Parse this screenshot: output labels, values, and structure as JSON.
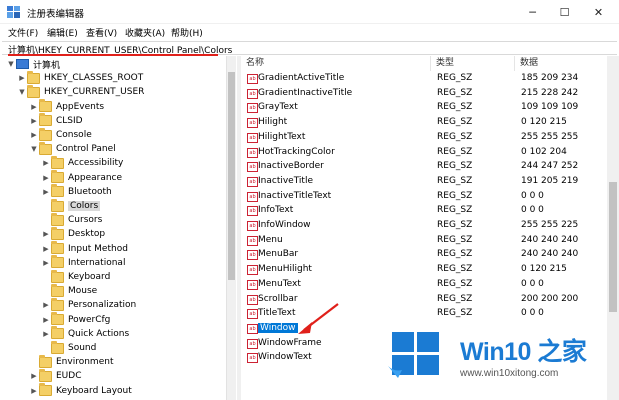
{
  "window": {
    "title": "注册表编辑器",
    "controls": {
      "minimize": "─",
      "maximize": "☐",
      "close": "✕"
    }
  },
  "menu": [
    "文件(F)",
    "编辑(E)",
    "查看(V)",
    "收藏夹(A)",
    "帮助(H)"
  ],
  "address": "计算机\\HKEY_CURRENT_USER\\Control Panel\\Colors",
  "colors": {
    "selection": "#0078d7",
    "accent": "#1b7bd3",
    "annotation": "#e0201a"
  },
  "tree": [
    {
      "label": "计算机",
      "arrow": "▼",
      "icon": "computer-icon"
    },
    {
      "label": "HKEY_CLASSES_ROOT",
      "arrow": "▶",
      "icon": "folder-icon"
    },
    {
      "label": "HKEY_CURRENT_USER",
      "arrow": "▼",
      "icon": "folder-icon"
    },
    {
      "label": "AppEvents",
      "arrow": "▶",
      "icon": "folder-icon"
    },
    {
      "label": "CLSID",
      "arrow": "▶",
      "icon": "folder-icon"
    },
    {
      "label": "Console",
      "arrow": "▶",
      "icon": "folder-icon"
    },
    {
      "label": "Control Panel",
      "arrow": "▼",
      "icon": "folder-icon"
    },
    {
      "label": "Accessibility",
      "arrow": "▶",
      "icon": "folder-icon"
    },
    {
      "label": "Appearance",
      "arrow": "▶",
      "icon": "folder-icon"
    },
    {
      "label": "Bluetooth",
      "arrow": "▶",
      "icon": "folder-icon"
    },
    {
      "label": "Colors",
      "arrow": "",
      "icon": "folder-icon",
      "selected": true
    },
    {
      "label": "Cursors",
      "arrow": "",
      "icon": "folder-icon"
    },
    {
      "label": "Desktop",
      "arrow": "▶",
      "icon": "folder-icon"
    },
    {
      "label": "Input Method",
      "arrow": "▶",
      "icon": "folder-icon"
    },
    {
      "label": "International",
      "arrow": "▶",
      "icon": "folder-icon"
    },
    {
      "label": "Keyboard",
      "arrow": "",
      "icon": "folder-icon"
    },
    {
      "label": "Mouse",
      "arrow": "",
      "icon": "folder-icon"
    },
    {
      "label": "Personalization",
      "arrow": "▶",
      "icon": "folder-icon"
    },
    {
      "label": "PowerCfg",
      "arrow": "▶",
      "icon": "folder-icon"
    },
    {
      "label": "Quick Actions",
      "arrow": "▶",
      "icon": "folder-icon"
    },
    {
      "label": "Sound",
      "arrow": "",
      "icon": "folder-icon"
    },
    {
      "label": "Environment",
      "arrow": "",
      "icon": "folder-icon"
    },
    {
      "label": "EUDC",
      "arrow": "▶",
      "icon": "folder-icon"
    },
    {
      "label": "Keyboard Layout",
      "arrow": "▶",
      "icon": "folder-icon"
    }
  ],
  "columns": {
    "name": "名称",
    "type": "类型",
    "data": "数据"
  },
  "values": [
    {
      "name": "GradientActiveTitle",
      "type": "REG_SZ",
      "data": "185 209 234"
    },
    {
      "name": "GradientInactiveTitle",
      "type": "REG_SZ",
      "data": "215 228 242"
    },
    {
      "name": "GrayText",
      "type": "REG_SZ",
      "data": "109 109 109"
    },
    {
      "name": "Hilight",
      "type": "REG_SZ",
      "data": "0 120 215"
    },
    {
      "name": "HilightText",
      "type": "REG_SZ",
      "data": "255 255 255"
    },
    {
      "name": "HotTrackingColor",
      "type": "REG_SZ",
      "data": "0 102 204"
    },
    {
      "name": "InactiveBorder",
      "type": "REG_SZ",
      "data": "244 247 252"
    },
    {
      "name": "InactiveTitle",
      "type": "REG_SZ",
      "data": "191 205 219"
    },
    {
      "name": "InactiveTitleText",
      "type": "REG_SZ",
      "data": "0 0 0"
    },
    {
      "name": "InfoText",
      "type": "REG_SZ",
      "data": "0 0 0"
    },
    {
      "name": "InfoWindow",
      "type": "REG_SZ",
      "data": "255 255 225"
    },
    {
      "name": "Menu",
      "type": "REG_SZ",
      "data": "240 240 240"
    },
    {
      "name": "MenuBar",
      "type": "REG_SZ",
      "data": "240 240 240"
    },
    {
      "name": "MenuHilight",
      "type": "REG_SZ",
      "data": "0 120 215"
    },
    {
      "name": "MenuText",
      "type": "REG_SZ",
      "data": "0 0 0"
    },
    {
      "name": "Scrollbar",
      "type": "REG_SZ",
      "data": "200 200 200"
    },
    {
      "name": "TitleText",
      "type": "REG_SZ",
      "data": "0 0 0"
    },
    {
      "name": "Window",
      "type": "",
      "data": "",
      "selected": true
    },
    {
      "name": "WindowFrame",
      "type": "",
      "data": ""
    },
    {
      "name": "WindowText",
      "type": "",
      "data": ""
    }
  ],
  "reg_icon_text": "ab",
  "watermark": {
    "title": "Win10 之家",
    "site": "www.win10xitong.com"
  }
}
